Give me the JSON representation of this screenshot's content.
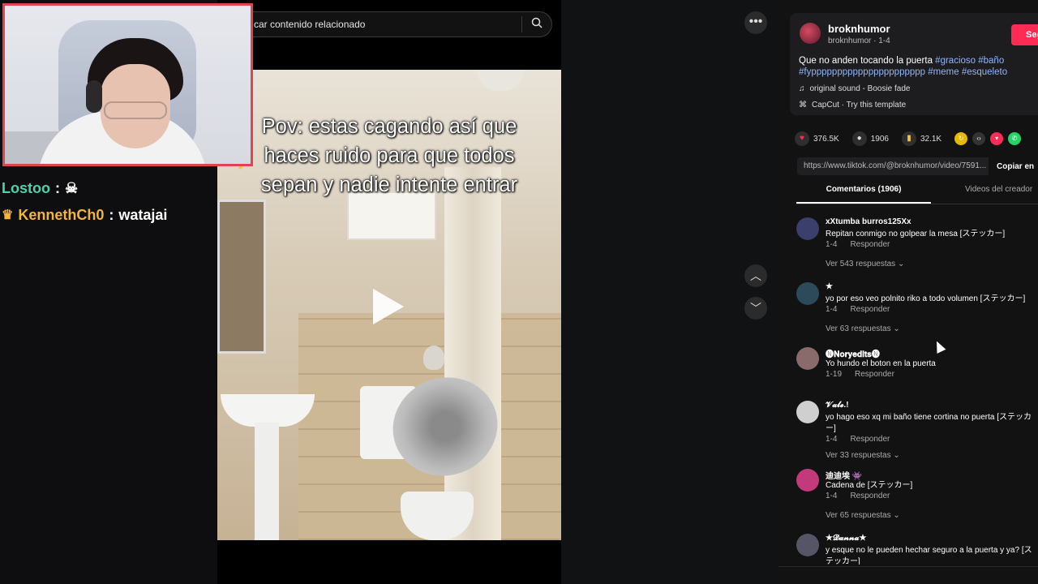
{
  "chat": {
    "lines": [
      {
        "user": "Lostoo",
        "sep": ":",
        "message": "☠"
      },
      {
        "user": "KennethCh0",
        "sep": ":",
        "message": "watajai"
      }
    ]
  },
  "search": {
    "placeholder": "car contenido relacionado",
    "icon": "search-icon"
  },
  "video": {
    "caption": "Pov: estas cagando así que haces ruido para que todos sepan y nadie intente entrar"
  },
  "post": {
    "author": "broknhumor",
    "author_sub": "broknhumor · 1-4",
    "follow_label": "Seg",
    "description_text": "Que no anden tocando la puerta ",
    "hashtags": [
      "#gracioso",
      "#baño",
      "#fypppppppppppppppppppppp",
      "#meme",
      "#esqueleto"
    ],
    "sound": "original sound - Boosie fade",
    "template": "CapCut · Try this template",
    "likes": "376.5K",
    "comments_count": "1906",
    "saves": "32.1K",
    "url": "https://www.tiktok.com/@broknhumor/video/7591...",
    "copy_label": "Copiar en"
  },
  "tabs": {
    "comments_label": "Comentarios (1906)",
    "creator_label": "Videos del creador"
  },
  "comments": [
    {
      "user": "xXtumba burros125Xx",
      "text": "Repitan conmigo no golpear la mesa [ステッカー]",
      "date": "1-4",
      "reply": "Responder",
      "more": "Ver 543 respuestas"
    },
    {
      "user": "★",
      "text": "yo por eso veo polnito riko a todo volumen [ステッカー]",
      "date": "1-4",
      "reply": "Responder",
      "more": "Ver 63 respuestas"
    },
    {
      "user": "🅝𝐍𝐨𝐫𝐲𝐞𝐝𝐢𝐭𝐬🅝",
      "text": "Yo hundo el boton en la puerta",
      "date": "1-19",
      "reply": "Responder",
      "more": ""
    },
    {
      "user": "𝓥𝓪𝓵𝓮.!",
      "text": "yo hago eso xq mi baño tiene cortina no puerta [ステッカー]",
      "date": "1-4",
      "reply": "Responder",
      "more": "Ver 33 respuestas"
    },
    {
      "user": "迪迪埃 👾",
      "text": "Cadena de [ステッカー]",
      "date": "1-4",
      "reply": "Responder",
      "more": "Ver 65 respuestas"
    },
    {
      "user": "★𝓓𝓪𝓷𝓷𝓪★",
      "text": "y esque no le pueden hechar seguro a la puerta y ya? [ステッカー]",
      "date": "",
      "reply": "",
      "more": ""
    }
  ],
  "colors": {
    "accent": "#fe2c55",
    "hashtag": "#8fb6ff",
    "chat_user1": "#4fd3a6",
    "chat_user2": "#f2b43a",
    "webcam_border": "#e0454f"
  }
}
